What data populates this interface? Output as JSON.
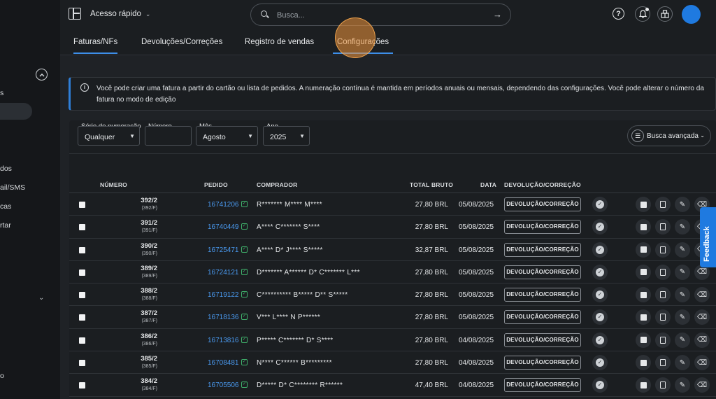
{
  "sidebar": {
    "items": [
      "s",
      "dos",
      "ail/SMS",
      "cas",
      "rtar",
      "o"
    ]
  },
  "header": {
    "quick_access": "Acesso rápido",
    "search_placeholder": "Busca..."
  },
  "tabs": [
    {
      "label": "Faturas/NFs",
      "active": true
    },
    {
      "label": "Devoluções/Correções"
    },
    {
      "label": "Registro de vendas"
    },
    {
      "label": "Configurações"
    }
  ],
  "info": {
    "text": "Você pode criar uma fatura a partir do cartão ou lista de pedidos. A numeração contínua é mantida em períodos anuais ou mensais, dependendo das configurações. Você pode alterar o número da fatura no modo de edição"
  },
  "filters": {
    "series_label": "Série de numeração",
    "series_value": "Qualquer",
    "number_label": "Número",
    "number_value": "",
    "month_label": "Mês",
    "month_value": "Agosto",
    "year_label": "Ano",
    "year_value": "2025",
    "advanced": "Busca avançada"
  },
  "table": {
    "headers": {
      "numero": "NÚMERO",
      "pedido": "PEDIDO",
      "comprador": "COMPRADOR",
      "total": "TOTAL BRUTO",
      "data": "DATA",
      "devolucao": "DEVOLUÇÃO/CORREÇÃO"
    },
    "devolucao_button": "DEVOLUÇÃO/CORREÇÃO",
    "rows": [
      {
        "num": "392/2",
        "sub": "(392/F)",
        "pedido": "16741206",
        "comprador": "R******* M**** M****",
        "total": "27,80 BRL",
        "data": "05/08/2025"
      },
      {
        "num": "391/2",
        "sub": "(391/F)",
        "pedido": "16740449",
        "comprador": "A**** C******* S****",
        "total": "27,80 BRL",
        "data": "05/08/2025"
      },
      {
        "num": "390/2",
        "sub": "(390/F)",
        "pedido": "16725471",
        "comprador": "A**** D* J**** S*****",
        "total": "32,87 BRL",
        "data": "05/08/2025"
      },
      {
        "num": "389/2",
        "sub": "(389/F)",
        "pedido": "16724121",
        "comprador": "D******* A****** D* C******* L***",
        "total": "27,80 BRL",
        "data": "05/08/2025"
      },
      {
        "num": "388/2",
        "sub": "(388/F)",
        "pedido": "16719122",
        "comprador": "C********** B***** D** S*****",
        "total": "27,80 BRL",
        "data": "05/08/2025"
      },
      {
        "num": "387/2",
        "sub": "(387/F)",
        "pedido": "16718136",
        "comprador": "V*** L**** N P******",
        "total": "27,80 BRL",
        "data": "05/08/2025"
      },
      {
        "num": "386/2",
        "sub": "(386/F)",
        "pedido": "16713816",
        "comprador": "P***** C******* D* S****",
        "total": "27,80 BRL",
        "data": "04/08/2025"
      },
      {
        "num": "385/2",
        "sub": "(385/F)",
        "pedido": "16708481",
        "comprador": "N**** C****** B*********",
        "total": "27,80 BRL",
        "data": "04/08/2025"
      },
      {
        "num": "384/2",
        "sub": "(384/F)",
        "pedido": "16705506",
        "comprador": "D***** D* C******** R******",
        "total": "47,40 BRL",
        "data": "04/08/2025"
      }
    ]
  },
  "feedback": "Feedback"
}
